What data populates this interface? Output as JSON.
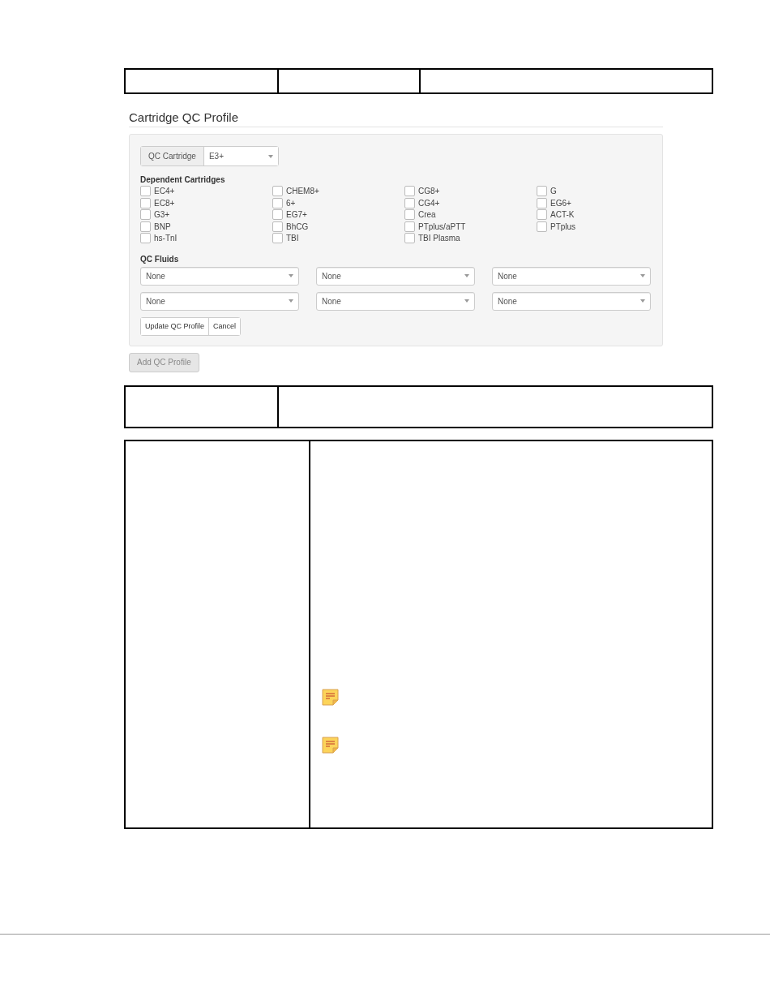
{
  "heading": "Cartridge QC Profile",
  "qc_cartridge": {
    "label": "QC Cartridge",
    "value": "E3+"
  },
  "dependent": {
    "title": "Dependent Cartridges",
    "items": [
      {
        "label": "EC4+",
        "checked": false
      },
      {
        "label": "CHEM8+",
        "checked": false
      },
      {
        "label": "CG8+",
        "checked": false
      },
      {
        "label": "G",
        "checked": false
      },
      {
        "label": "EC8+",
        "checked": false
      },
      {
        "label": "6+",
        "checked": false
      },
      {
        "label": "CG4+",
        "checked": false
      },
      {
        "label": "EG6+",
        "checked": false
      },
      {
        "label": "G3+",
        "checked": false
      },
      {
        "label": "EG7+",
        "checked": false
      },
      {
        "label": "Crea",
        "checked": false
      },
      {
        "label": "ACT-K",
        "checked": false
      },
      {
        "label": "BNP",
        "checked": false
      },
      {
        "label": "BhCG",
        "checked": false
      },
      {
        "label": "PTplus/aPTT",
        "checked": false
      },
      {
        "label": "PTplus",
        "checked": false
      },
      {
        "label": "hs-TnI",
        "checked": false
      },
      {
        "label": "TBI",
        "checked": false
      },
      {
        "label": "TBI Plasma",
        "checked": false
      }
    ]
  },
  "fluids": {
    "title": "QC Fluids",
    "selects": [
      {
        "value": "None"
      },
      {
        "value": "None"
      },
      {
        "value": "None"
      },
      {
        "value": "None"
      },
      {
        "value": "None"
      },
      {
        "value": "None"
      }
    ]
  },
  "form_buttons": [
    "Update QC Profile",
    "Cancel"
  ],
  "add_button": {
    "label": "Add QC Profile",
    "disabled": true
  }
}
